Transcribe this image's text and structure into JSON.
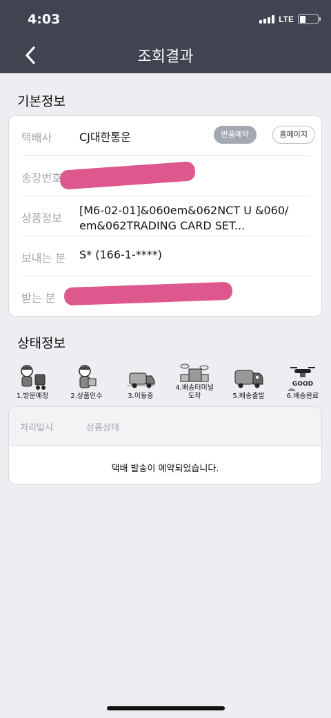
{
  "status_bar": {
    "time": "4:03",
    "network": "LTE"
  },
  "header": {
    "title": "조회결과"
  },
  "basic_info": {
    "title": "기본정보",
    "rows": [
      {
        "label": "택배사",
        "value": "CJ대한통운"
      },
      {
        "label": "송장번호",
        "value": ""
      },
      {
        "label": "상품정보",
        "value": "[M6-02-01]&060em&062NCT U &060/\nem&062TRADING CARD SET..."
      },
      {
        "label": "보내는 분",
        "value": "S* (166-1-****)"
      },
      {
        "label": "받는 분",
        "value": ""
      }
    ],
    "buttons": {
      "return": "반품예약",
      "homepage": "홈페이지"
    }
  },
  "status_info": {
    "title": "상태정보",
    "steps": [
      {
        "label": "1.방문예정",
        "icon": "courier-with-cart-icon"
      },
      {
        "label": "2.상품인수",
        "icon": "courier-with-box-icon"
      },
      {
        "label": "3.이동중",
        "icon": "truck-moving-icon"
      },
      {
        "label": "4.배송터미널\n도착",
        "icon": "terminal-building-icon"
      },
      {
        "label": "5.배송출발",
        "icon": "truck-departing-icon"
      },
      {
        "label": "6.배송완료",
        "icon": "drone-good-icon"
      }
    ],
    "table": {
      "columns": [
        "처리일시",
        "상품상태"
      ],
      "message": "택배 발송이 예약되었습니다."
    }
  }
}
